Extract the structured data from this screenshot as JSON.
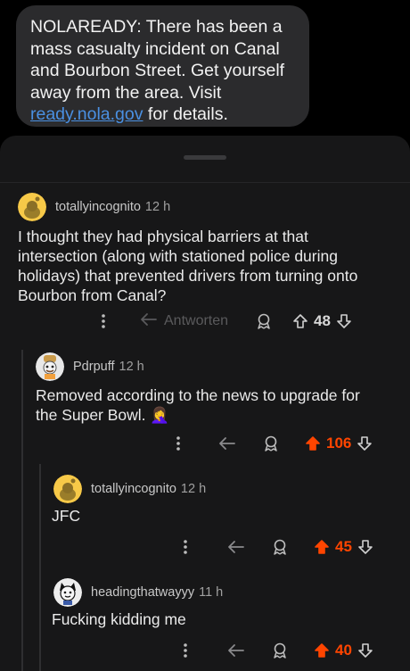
{
  "sms": {
    "line1": "NOLAREADY: There has been a",
    "line2": "mass casualty incident on Canal",
    "line3": "and Bourbon Street. Get yourself",
    "line4": "away from the area. Visit",
    "link": "ready.nola.gov",
    "link_suffix": " for details."
  },
  "comments": [
    {
      "user": "totallyincognito",
      "time": "12 h",
      "lines": [
        "I thought they had physical barriers at that",
        "intersection (along with stationed police during",
        "holidays) that prevented drivers from turning onto",
        "Bourbon from Canal?"
      ],
      "reply_label": "Antworten",
      "score": "48",
      "upvoted": false
    },
    {
      "user": "Pdrpuff",
      "time": "12 h",
      "lines": [
        "Removed according to the news to upgrade for",
        "the Super Bowl. "
      ],
      "emoji": "🤦‍♀️",
      "score": "106",
      "upvoted": true
    },
    {
      "user": "totallyincognito",
      "time": "12 h",
      "lines": [
        "JFC"
      ],
      "score": "45",
      "upvoted": true
    },
    {
      "user": "headingthatwayyy",
      "time": "11 h",
      "lines": [
        "Fucking kidding me"
      ],
      "score": "40",
      "upvoted": true
    }
  ],
  "colors": {
    "upvote": "#ff4500",
    "link": "#4a90e2",
    "background": "#171718"
  },
  "icons": [
    "more-icon",
    "reply-icon",
    "award-icon",
    "upvote-icon",
    "downvote-icon"
  ]
}
